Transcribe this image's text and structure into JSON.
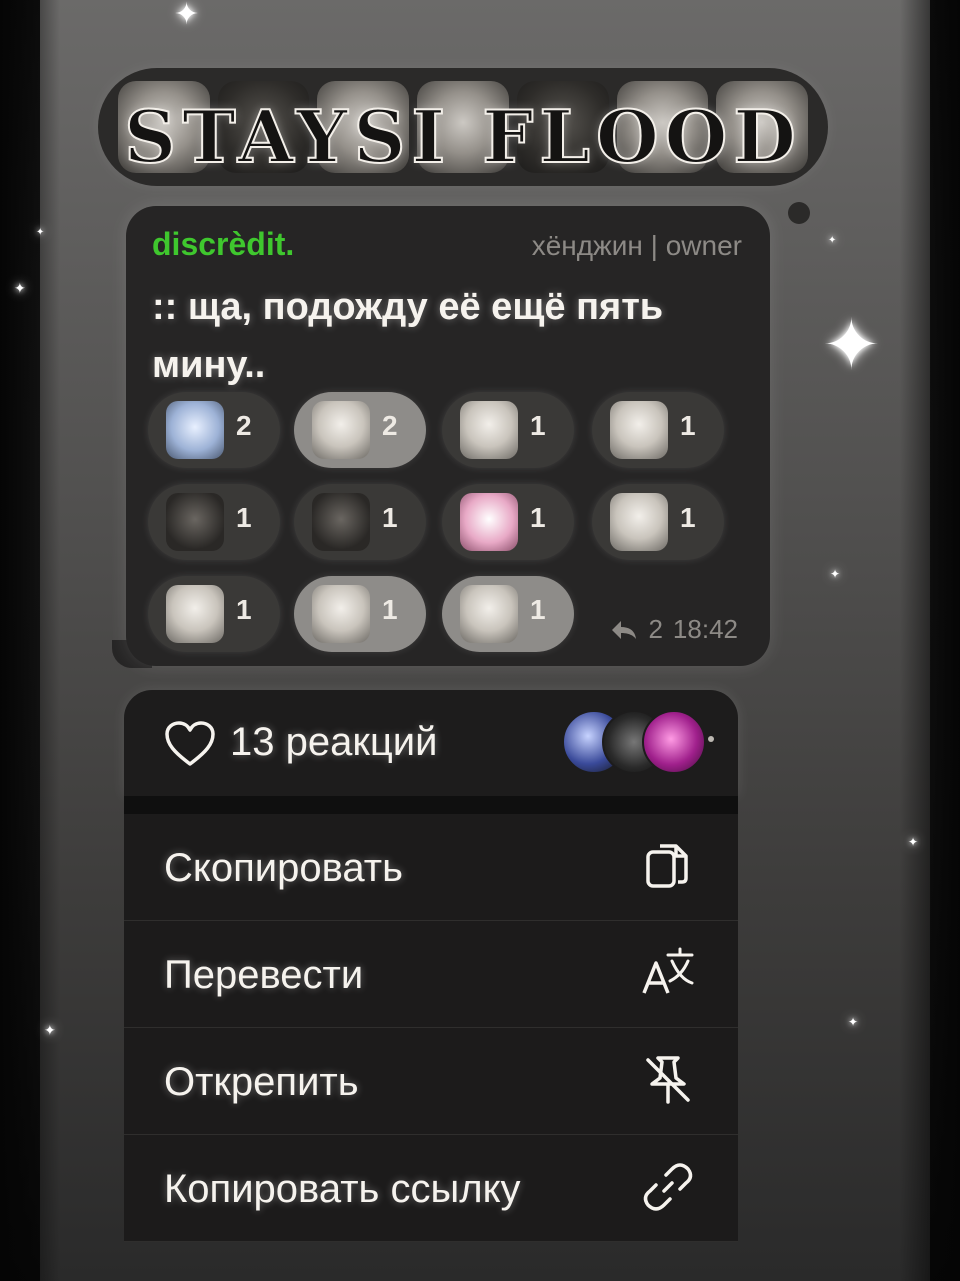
{
  "banner": {
    "title": "STAYSI FLOOD"
  },
  "message": {
    "sender": "discrèdit.",
    "role": "хёнджин | owner",
    "text": ":: ща, подожду её ещё пять мину..",
    "reply_count": "2",
    "time": "18:42",
    "reactions": [
      {
        "icon": "sleeping-cat-sticker-icon",
        "count": "2",
        "active": false,
        "tone": "blue"
      },
      {
        "icon": "sad-cat-face-sticker-icon",
        "count": "2",
        "active": true,
        "tone": "light"
      },
      {
        "icon": "white-kitten-sticker-icon",
        "count": "1",
        "active": false,
        "tone": "light"
      },
      {
        "icon": "tabby-cat-face-sticker-icon",
        "count": "1",
        "active": false,
        "tone": "light"
      },
      {
        "icon": "dark-cat-sticker-icon",
        "count": "1",
        "active": false,
        "tone": "dark"
      },
      {
        "icon": "siamese-cat-sticker-icon",
        "count": "1",
        "active": false,
        "tone": "dark"
      },
      {
        "icon": "marie-cat-sticker-icon",
        "count": "1",
        "active": false,
        "tone": "pink"
      },
      {
        "icon": "walking-kitten-sticker-icon",
        "count": "1",
        "active": false,
        "tone": "light"
      },
      {
        "icon": "calico-cat-sticker-icon",
        "count": "1",
        "active": false,
        "tone": "light"
      },
      {
        "icon": "cat-with-mug-sticker-icon",
        "count": "1",
        "active": true,
        "tone": "light"
      },
      {
        "icon": "lying-cat-sticker-icon",
        "count": "1",
        "active": true,
        "tone": "light"
      }
    ]
  },
  "menu": {
    "reactions_label": "13 реакций",
    "items": [
      {
        "label": "Скопировать",
        "icon": "copy-icon"
      },
      {
        "label": "Перевести",
        "icon": "translate-icon"
      },
      {
        "label": "Открепить",
        "icon": "unpin-icon"
      },
      {
        "label": "Копировать ссылку",
        "icon": "link-icon"
      }
    ]
  }
}
